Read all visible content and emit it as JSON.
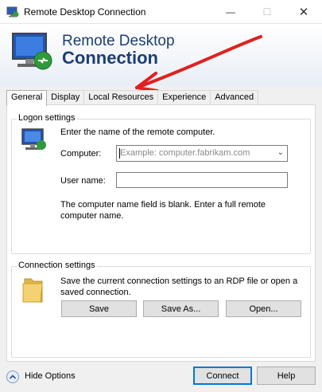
{
  "window": {
    "title": "Remote Desktop Connection",
    "controls": [
      "minimize",
      "maximize",
      "close"
    ]
  },
  "banner": {
    "line1": "Remote Desktop",
    "line2": "Connection"
  },
  "tabs": [
    {
      "label": "General",
      "active": true
    },
    {
      "label": "Display",
      "active": false
    },
    {
      "label": "Local Resources",
      "active": false
    },
    {
      "label": "Experience",
      "active": false
    },
    {
      "label": "Advanced",
      "active": false
    }
  ],
  "logon": {
    "legend": "Logon settings",
    "instruction": "Enter the name of the remote computer.",
    "computer_label": "Computer:",
    "computer_placeholder": "Example: computer.fabrikam.com",
    "username_label": "User name:",
    "username_value": "",
    "warning": "The computer name field is blank. Enter a full remote computer name."
  },
  "connection": {
    "legend": "Connection settings",
    "description": "Save the current connection settings to an RDP file or open a saved connection.",
    "save_label": "Save",
    "saveas_label": "Save As...",
    "open_label": "Open..."
  },
  "footer": {
    "hide_options_label": "Hide Options",
    "connect_label": "Connect",
    "help_label": "Help"
  },
  "colors": {
    "banner_text": "#1d3e73",
    "arrow": "#e02020",
    "focus_border": "#0078d7"
  }
}
